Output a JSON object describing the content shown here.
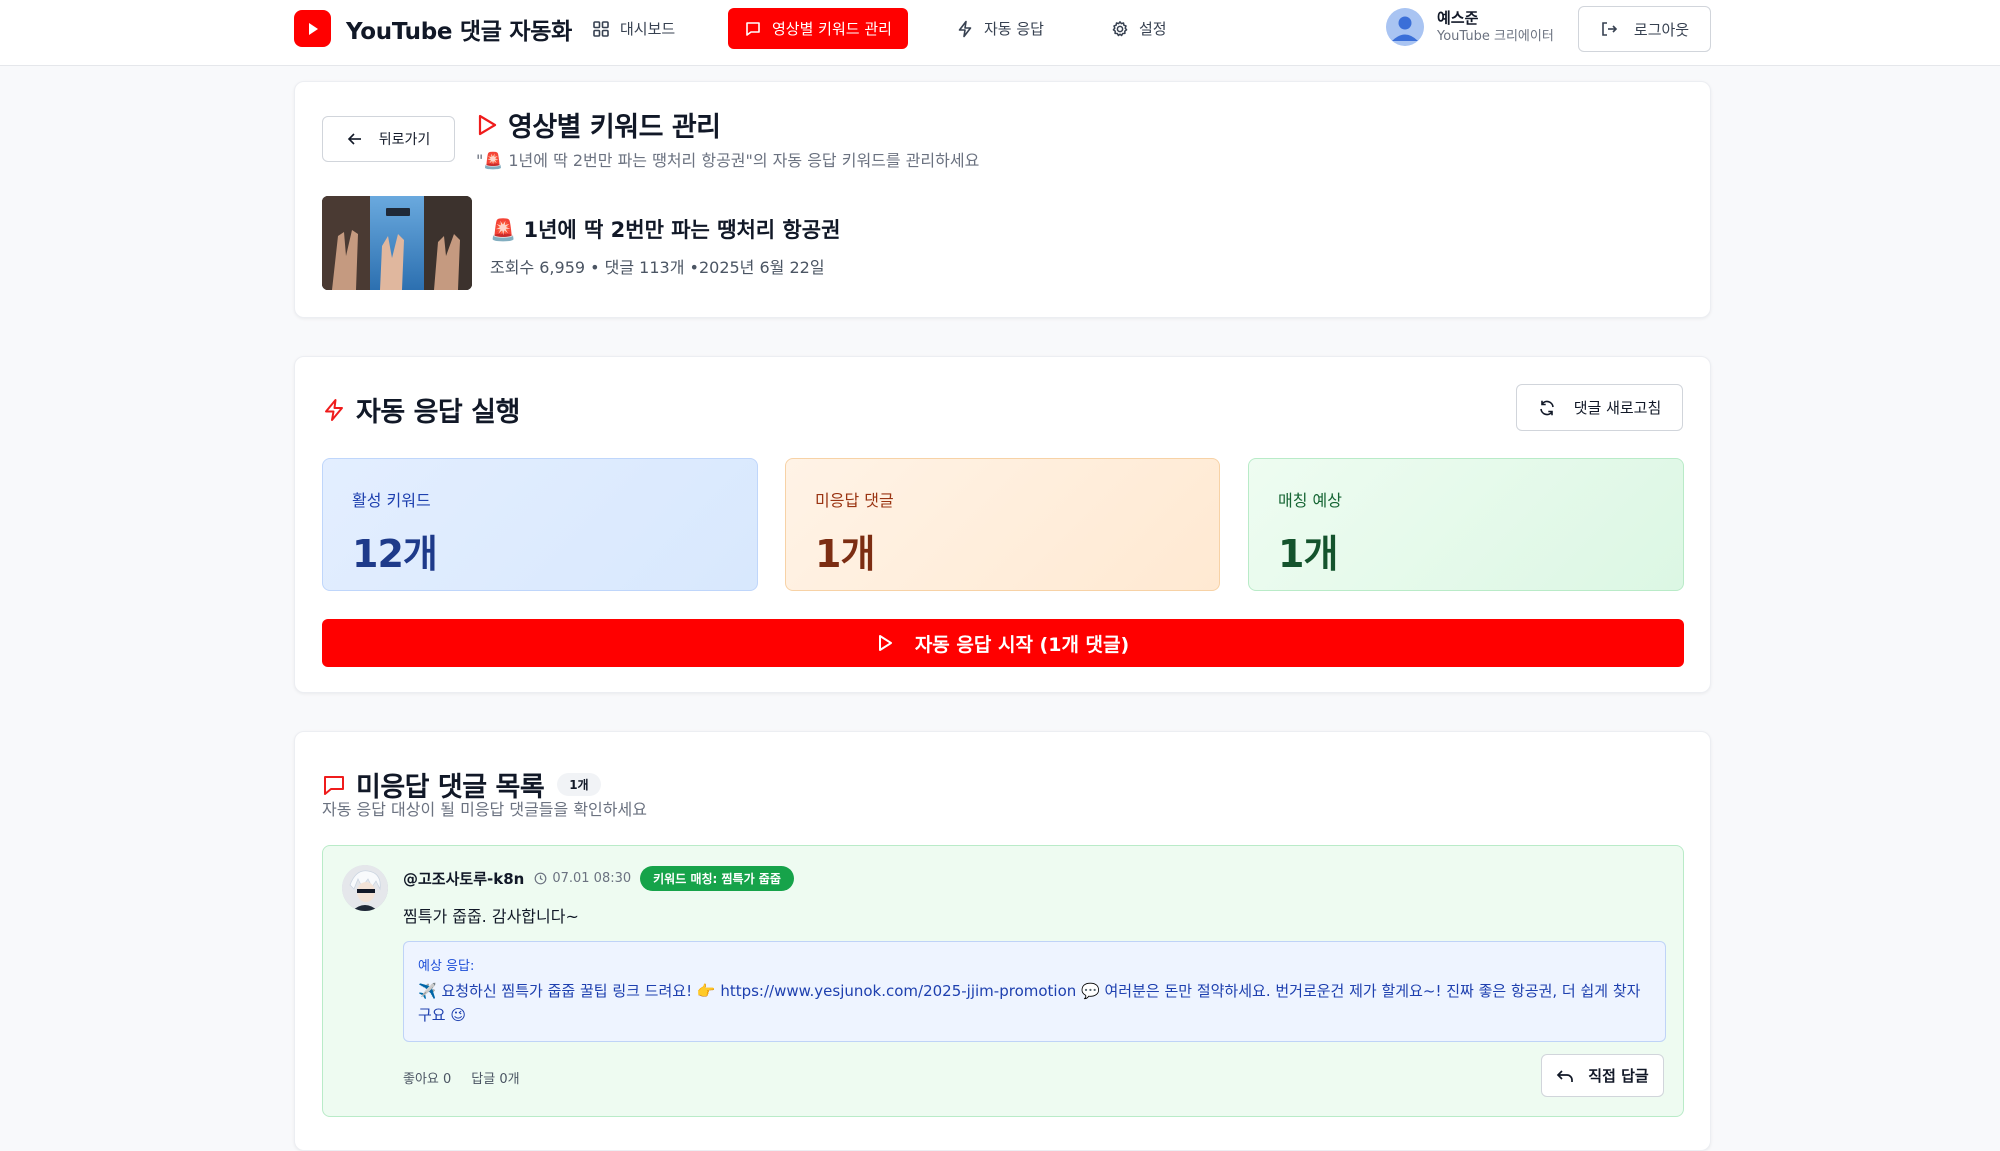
{
  "app": {
    "title": "YouTube 댓글 자동화"
  },
  "nav": {
    "items": [
      {
        "label": "대시보드",
        "icon": "grid-icon"
      },
      {
        "label": "영상별 키워드 관리",
        "icon": "message-square-icon",
        "active": true
      },
      {
        "label": "자동 응답",
        "icon": "zap-icon"
      },
      {
        "label": "설정",
        "icon": "gear-icon"
      }
    ]
  },
  "user": {
    "name": "예스준",
    "role": "YouTube 크리에이터",
    "logout_label": "로그아웃"
  },
  "header": {
    "back_label": "뒤로가기",
    "title": "영상별 키워드 관리",
    "subtitle": "\"🚨 1년에 딱 2번만 파는 땡처리 항공권\"의 자동 응답 키워드를 관리하세요",
    "video": {
      "title": "🚨 1년에 딱 2번만 파는 땡처리 항공권",
      "meta": "조회수 6,959 • 댓글 113개 •2025년 6월 22일"
    }
  },
  "auto": {
    "title": "자동 응답 실행",
    "refresh_label": "댓글 새로고침",
    "stats": [
      {
        "label": "활성 키워드",
        "value": "12개"
      },
      {
        "label": "미응답 댓글",
        "value": "1개"
      },
      {
        "label": "매칭 예상",
        "value": "1개"
      }
    ],
    "start_label": "자동 응답 시작 (1개 댓글)"
  },
  "comments": {
    "title": "미응답 댓글 목록",
    "count": "1개",
    "description": "자동 응답 대상이 될 미응답 댓글들을 확인하세요",
    "items": [
      {
        "author": "@고조사토루-k8n",
        "time": "07.01 08:30",
        "badge": "키워드 매칭: 찜특가 줍줍",
        "text": "찜특가 줍줍. 감사합니다~",
        "expected_label": "예상 응답:",
        "expected_text": "✈️ 요청하신 찜특가 줍줍 꿀팁 링크 드려요! 👉 https://www.yesjunok.com/2025-jjim-promotion 💬 여러분은 돈만 절약하세요. 번거로운건 제가 할게요~! 진짜 좋은 항공권, 더 쉽게 찾자구요 😉",
        "likes": "좋아요 0",
        "replies": "답글 0개",
        "reply_label": "직접 답글"
      }
    ]
  },
  "colors": {
    "brand": "#ff0000",
    "match_green": "#16a34a"
  }
}
